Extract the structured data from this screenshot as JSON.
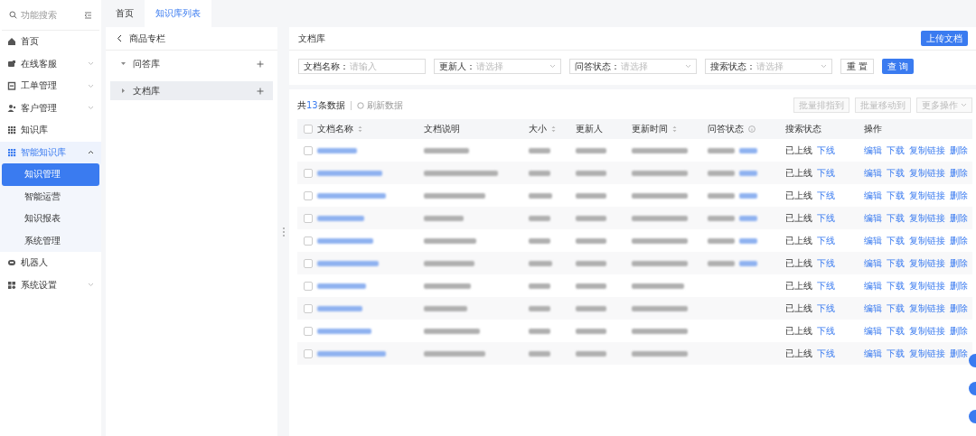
{
  "sidebar": {
    "search_placeholder": "功能搜索",
    "items": [
      {
        "label": "首页",
        "expanded": false,
        "has_children": false
      },
      {
        "label": "在线客服",
        "expanded": false,
        "has_children": true
      },
      {
        "label": "工单管理",
        "expanded": false,
        "has_children": true
      },
      {
        "label": "客户管理",
        "expanded": false,
        "has_children": true
      },
      {
        "label": "知识库",
        "expanded": false,
        "has_children": false
      },
      {
        "label": "智能知识库",
        "expanded": true,
        "has_children": true,
        "children": [
          {
            "label": "知识管理",
            "selected": true
          },
          {
            "label": "智能运营",
            "selected": false
          },
          {
            "label": "知识报表",
            "selected": false
          },
          {
            "label": "系统管理",
            "selected": false
          }
        ]
      },
      {
        "label": "机器人",
        "expanded": false,
        "has_children": false
      },
      {
        "label": "系统设置",
        "expanded": false,
        "has_children": true
      }
    ]
  },
  "tabs": [
    {
      "label": "首页",
      "selected": false
    },
    {
      "label": "知识库列表",
      "selected": true
    }
  ],
  "tree": {
    "title": "商品专栏",
    "items": [
      {
        "label": "问答库",
        "expanded": true,
        "selected": false
      },
      {
        "label": "文档库",
        "expanded": false,
        "selected": true
      }
    ]
  },
  "header": {
    "title": "文档库",
    "upload_button": "上传文档"
  },
  "filters": [
    {
      "label": "文档名称：",
      "placeholder": "请输入",
      "kind": "input"
    },
    {
      "label": "更新人：",
      "placeholder": "请选择",
      "kind": "select"
    },
    {
      "label": "问答状态：",
      "placeholder": "请选择",
      "kind": "select"
    },
    {
      "label": "搜索状态：",
      "placeholder": "请选择",
      "kind": "select"
    }
  ],
  "filter_buttons": {
    "reset": "重 置",
    "search": "查 询"
  },
  "toolbar": {
    "count_prefix": "共",
    "count": "13",
    "count_suffix": "条数据",
    "refresh": "刷新数据",
    "batch_buttons": [
      "批量排指到",
      "批量移动到"
    ],
    "more": "更多操作"
  },
  "table": {
    "all_checked": false,
    "columns": [
      {
        "label": "文档名称",
        "sortable": true,
        "info": false
      },
      {
        "label": "文档说明",
        "sortable": false,
        "info": false
      },
      {
        "label": "大小",
        "sortable": true,
        "info": false
      },
      {
        "label": "更新人",
        "sortable": false,
        "info": false
      },
      {
        "label": "更新时间",
        "sortable": true,
        "info": false
      },
      {
        "label": "问答状态",
        "sortable": false,
        "info": true
      },
      {
        "label": "搜索状态",
        "sortable": false,
        "info": false
      },
      {
        "label": "操作",
        "sortable": false,
        "info": false
      }
    ],
    "rows": [
      {
        "checked": false,
        "qa_status_shown": true,
        "search_status": "已上线",
        "actions": [
          "下线",
          "编辑",
          "下载",
          "复制链接",
          "删除"
        ]
      },
      {
        "checked": false,
        "qa_status_shown": true,
        "search_status": "已上线",
        "actions": [
          "下线",
          "编辑",
          "下载",
          "复制链接",
          "删除"
        ]
      },
      {
        "checked": false,
        "qa_status_shown": true,
        "search_status": "已上线",
        "actions": [
          "下线",
          "编辑",
          "下载",
          "复制链接",
          "删除"
        ]
      },
      {
        "checked": false,
        "qa_status_shown": true,
        "search_status": "已上线",
        "actions": [
          "下线",
          "编辑",
          "下载",
          "复制链接",
          "删除"
        ]
      },
      {
        "checked": false,
        "qa_status_shown": true,
        "search_status": "已上线",
        "actions": [
          "下线",
          "编辑",
          "下载",
          "复制链接",
          "删除"
        ]
      },
      {
        "checked": false,
        "qa_status_shown": true,
        "search_status": "已上线",
        "actions": [
          "下线",
          "编辑",
          "下载",
          "复制链接",
          "删除"
        ]
      },
      {
        "checked": false,
        "qa_status_shown": false,
        "search_status": "已上线",
        "actions": [
          "下线",
          "编辑",
          "下载",
          "复制链接",
          "删除"
        ]
      },
      {
        "checked": false,
        "qa_status_shown": false,
        "search_status": "已上线",
        "actions": [
          "下线",
          "编辑",
          "下载",
          "复制链接",
          "删除"
        ]
      },
      {
        "checked": false,
        "qa_status_shown": false,
        "search_status": "已上线",
        "actions": [
          "下线",
          "编辑",
          "下载",
          "复制链接",
          "删除"
        ]
      },
      {
        "checked": false,
        "qa_status_shown": false,
        "search_status": "已上线",
        "actions": [
          "下线",
          "编辑",
          "下载",
          "复制链接",
          "删除"
        ]
      }
    ]
  }
}
